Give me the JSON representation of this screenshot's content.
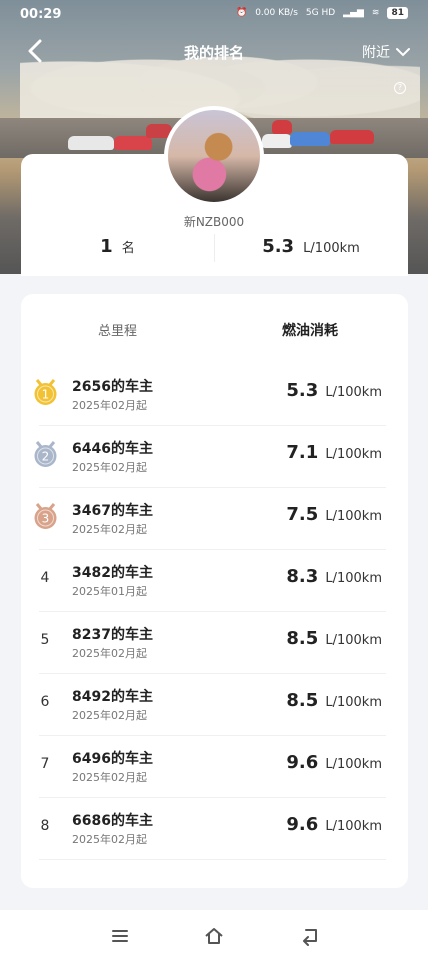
{
  "status_bar": {
    "time": "00:29",
    "speed": "0.00 KB/s",
    "network": "5G HD",
    "battery": "81"
  },
  "nav": {
    "title": "我的排名",
    "filter": "附近"
  },
  "profile": {
    "username": "新NZB000",
    "rank_value": "1",
    "rank_unit": "名",
    "fuel_value": "5.3",
    "fuel_unit": "L/100km"
  },
  "tabs": {
    "mileage": "总里程",
    "fuel": "燃油消耗"
  },
  "ranking": [
    {
      "rank": "1",
      "owner": "2656的车主",
      "since": "2025年02月起",
      "value": "5.3",
      "unit": "L/100km",
      "medal": "gold"
    },
    {
      "rank": "2",
      "owner": "6446的车主",
      "since": "2025年02月起",
      "value": "7.1",
      "unit": "L/100km",
      "medal": "silver"
    },
    {
      "rank": "3",
      "owner": "3467的车主",
      "since": "2025年02月起",
      "value": "7.5",
      "unit": "L/100km",
      "medal": "bronze"
    },
    {
      "rank": "4",
      "owner": "3482的车主",
      "since": "2025年01月起",
      "value": "8.3",
      "unit": "L/100km"
    },
    {
      "rank": "5",
      "owner": "8237的车主",
      "since": "2025年02月起",
      "value": "8.5",
      "unit": "L/100km"
    },
    {
      "rank": "6",
      "owner": "8492的车主",
      "since": "2025年02月起",
      "value": "8.5",
      "unit": "L/100km"
    },
    {
      "rank": "7",
      "owner": "6496的车主",
      "since": "2025年02月起",
      "value": "9.6",
      "unit": "L/100km"
    },
    {
      "rank": "8",
      "owner": "6686的车主",
      "since": "2025年02月起",
      "value": "9.6",
      "unit": "L/100km"
    }
  ],
  "colors": {
    "gold": "#f2c234",
    "silver": "#aab6c9",
    "bronze": "#d8a38a"
  }
}
